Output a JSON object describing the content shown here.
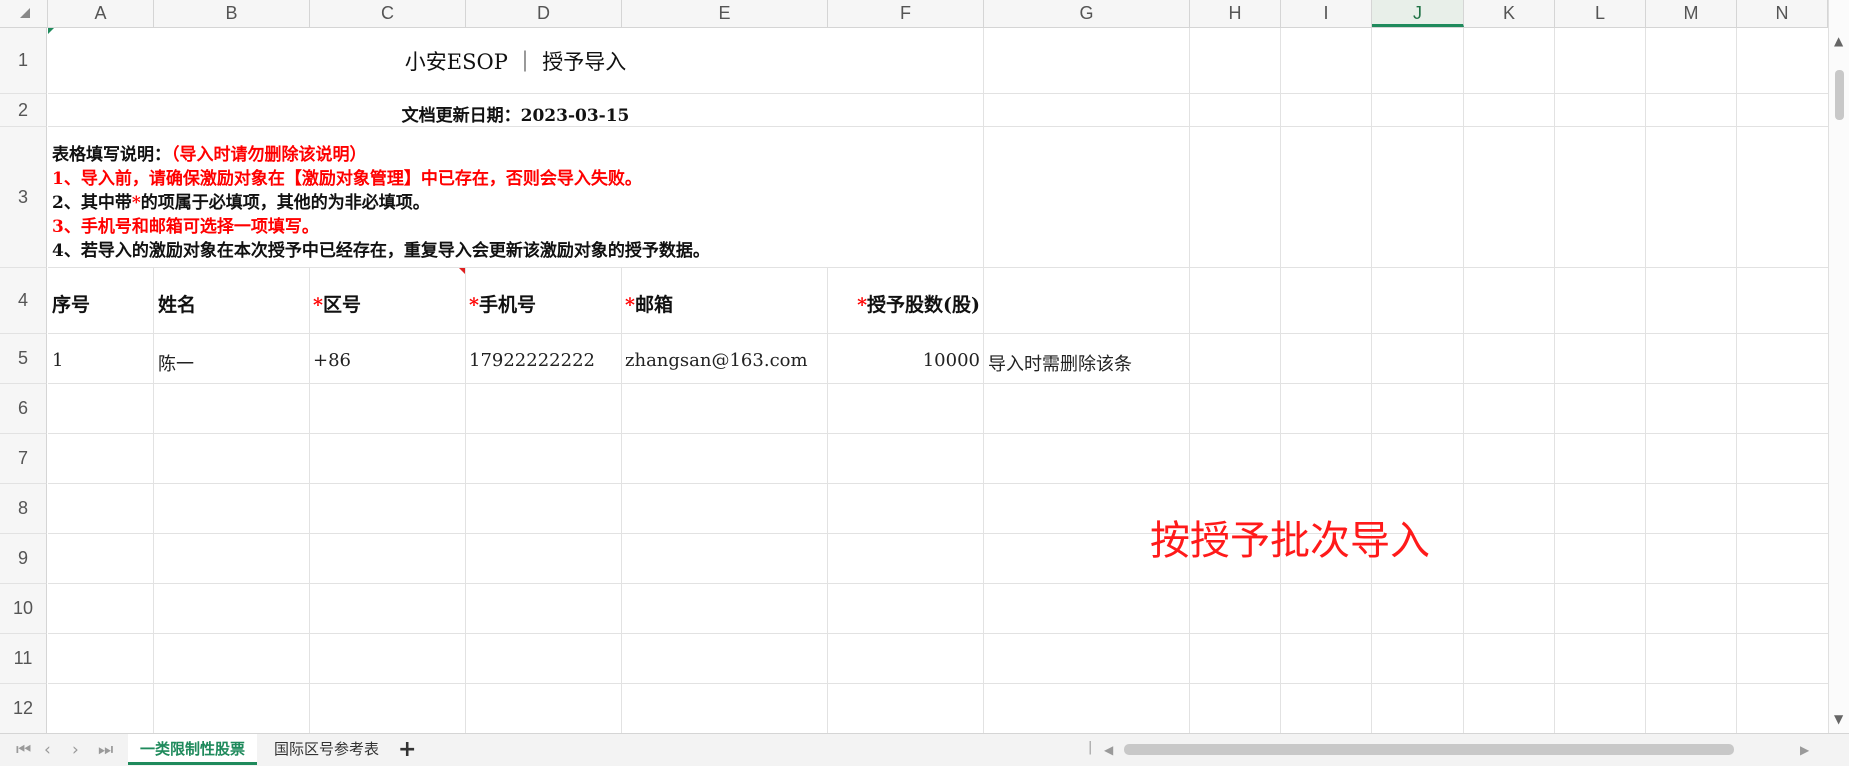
{
  "columns": [
    "A",
    "B",
    "C",
    "D",
    "E",
    "F",
    "G",
    "H",
    "I",
    "J",
    "K",
    "L",
    "M",
    "N"
  ],
  "active_column": "J",
  "rows": [
    "1",
    "2",
    "3",
    "4",
    "5",
    "6",
    "7",
    "8",
    "9",
    "10",
    "11",
    "12"
  ],
  "sheet": {
    "title": "小安ESOP ｜ 授予导入",
    "updated": "文档更新日期：2023-03-15",
    "instructions": {
      "line0_black": "表格填写说明：",
      "line0_red": "（导入时请勿删除该说明）",
      "line1": "1、导入前，请确保激励对象在【激励对象管理】中已存在，否则会导入失败。",
      "line2_a": "2、其中带",
      "line2_star": "*",
      "line2_b": "的项属于必填项，其他的为非必填项。",
      "line3": "3、手机号和邮箱可选择一项填写。",
      "line4": "4、若导入的激励对象在本次授予中已经存在，重复导入会更新该激励对象的授予数据。"
    },
    "headers": {
      "seq": "序号",
      "name": "姓名",
      "star": "*",
      "area": "区号",
      "phone": "手机号",
      "email": "邮箱",
      "shares": "授予股数(股)"
    },
    "row5": {
      "seq": "1",
      "name": "陈一",
      "area": "+86",
      "phone": "17922222222",
      "email": "zhangsan@163.com",
      "shares": "10000",
      "note": "导入时需删除该条"
    }
  },
  "overlay_text": "按授予批次导入",
  "sheet_tabs": [
    "一类限制性股票",
    "国际区号参考表"
  ],
  "active_sheet_tab": 0,
  "colors": {
    "accent": "#1f8a5c",
    "red": "#ff0000"
  }
}
